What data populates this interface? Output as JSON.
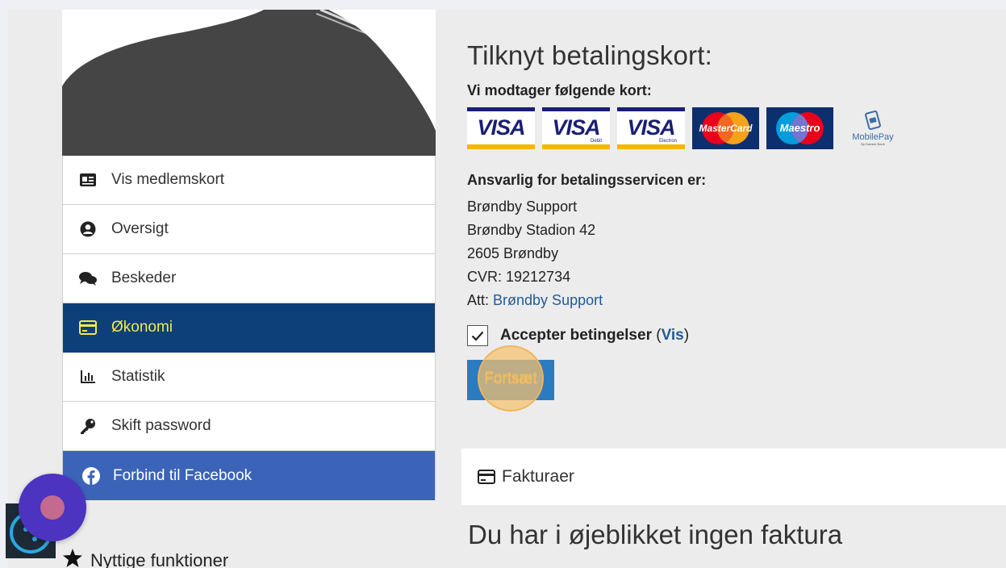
{
  "menu": {
    "items": [
      {
        "label": "Vis medlemskort",
        "icon": "id-card-icon"
      },
      {
        "label": "Oversigt",
        "icon": "user-circle-icon"
      },
      {
        "label": "Beskeder",
        "icon": "comments-icon"
      },
      {
        "label": "Økonomi",
        "icon": "credit-card-icon",
        "active": true
      },
      {
        "label": "Statistik",
        "icon": "bar-chart-icon"
      },
      {
        "label": "Skift password",
        "icon": "key-icon"
      }
    ],
    "facebook_label": "Forbind til Facebook"
  },
  "useful_functions_label": "Nyttige funktioner",
  "payment": {
    "title": "Tilknyt betalingskort:",
    "cards_label": "Vi modtager følgende kort:",
    "cards": [
      {
        "brand": "VISA",
        "sub": ""
      },
      {
        "brand": "VISA",
        "sub": "Debit"
      },
      {
        "brand": "VISA",
        "sub": "Electron"
      },
      {
        "brand": "MasterCard"
      },
      {
        "brand": "Maestro"
      },
      {
        "brand": "MobilePay",
        "sub": "By Danske Bank"
      }
    ],
    "responsible_label": "Ansvarlig for betalingsservicen er:",
    "address_lines": [
      "Brøndby Support",
      "Brøndby Stadion 42",
      "2605 Brøndby",
      "CVR: 19212734"
    ],
    "att_prefix": "Att:",
    "att_link": "Brøndby Support",
    "accept_label": "Accepter betingelser",
    "accept_open": "(",
    "accept_link": "Vis",
    "accept_close": ")",
    "accept_checked": true,
    "continue_label": "Fortsæt"
  },
  "invoices": {
    "header": "Fakturaer",
    "empty_message": "Du har i øjeblikket ingen faktura"
  },
  "colors": {
    "active_menu_bg": "#0d3f78",
    "active_menu_text": "#f2e94e",
    "facebook_bg": "#3b63b8",
    "button_bg": "#2b7bc0",
    "link": "#245a92"
  }
}
